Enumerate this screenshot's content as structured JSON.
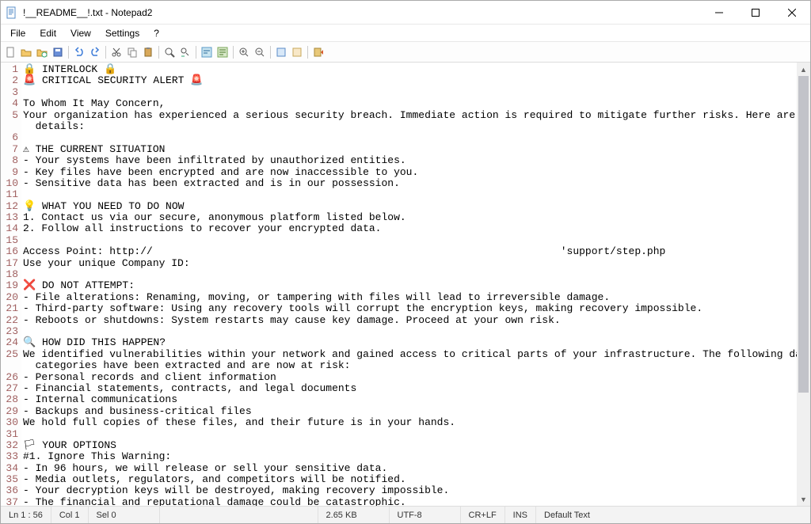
{
  "titlebar": {
    "title": "!__README__!.txt - Notepad2"
  },
  "menus": {
    "file": "File",
    "edit": "Edit",
    "view": "View",
    "settings": "Settings",
    "help": "?"
  },
  "status": {
    "pos": "Ln 1 : 56",
    "col": "Col 1",
    "sel": "Sel 0",
    "size": "2.65 KB",
    "encoding": "UTF-8",
    "eol": "CR+LF",
    "ins": "INS",
    "scheme": "Default Text"
  },
  "lines": [
    "🔒 INTERLOCK 🔒",
    "🚨 CRITICAL SECURITY ALERT 🚨",
    "",
    "To Whom It May Concern,",
    "Your organization has experienced a serious security breach. Immediate action is required to mitigate further risks. Here are the details:",
    "",
    "⚠ THE CURRENT SITUATION",
    "- Your systems have been infiltrated by unauthorized entities.",
    "- Key files have been encrypted and are now inaccessible to you.",
    "- Sensitive data has been extracted and is in our possession.",
    "",
    "💡 WHAT YOU NEED TO DO NOW",
    "1. Contact us via our secure, anonymous platform listed below.",
    "2. Follow all instructions to recover your encrypted data.",
    "",
    "Access Point: http://                                                                  'support/step.php",
    "Use your unique Company ID:",
    "",
    "❌ DO NOT ATTEMPT:",
    "- File alterations: Renaming, moving, or tampering with files will lead to irreversible damage.",
    "- Third-party software: Using any recovery tools will corrupt the encryption keys, making recovery impossible.",
    "- Reboots or shutdowns: System restarts may cause key damage. Proceed at your own risk.",
    "",
    "🔍 HOW DID THIS HAPPEN?",
    "We identified vulnerabilities within your network and gained access to critical parts of your infrastructure. The following data categories have been extracted and are now at risk:",
    "- Personal records and client information",
    "- Financial statements, contracts, and legal documents",
    "- Internal communications",
    "- Backups and business-critical files",
    "We hold full copies of these files, and their future is in your hands.",
    "",
    "🏳 YOUR OPTIONS",
    "#1. Ignore This Warning:",
    "- In 96 hours, we will release or sell your sensitive data.",
    "- Media outlets, regulators, and competitors will be notified.",
    "- Your decryption keys will be destroyed, making recovery impossible.",
    "- The financial and reputational damage could be catastrophic.",
    ""
  ],
  "wrap_indent": "  "
}
